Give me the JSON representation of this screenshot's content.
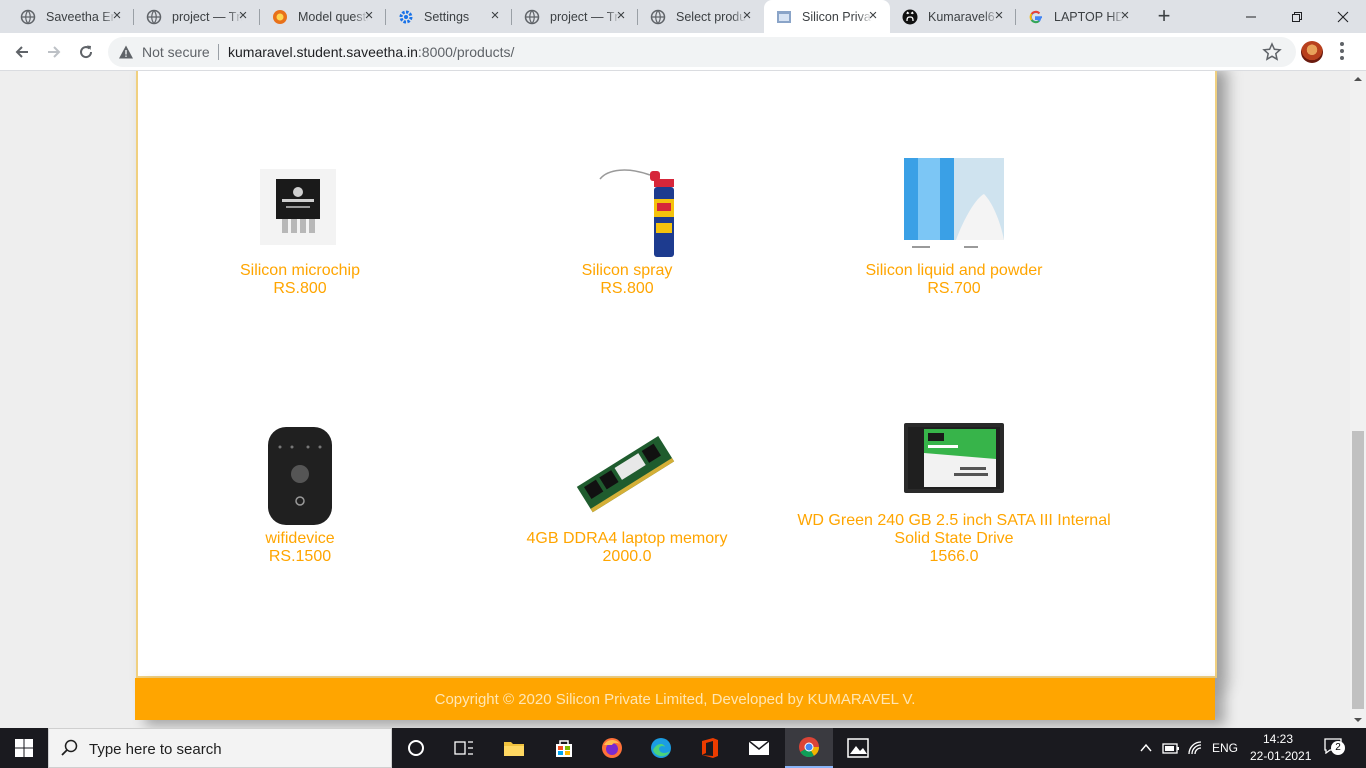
{
  "browser": {
    "tabs": [
      {
        "title": "Saveetha Engineering College",
        "icon": "saveetha-globe-icon",
        "active": false
      },
      {
        "title": "project — Tmp",
        "icon": "globe-icon",
        "active": false
      },
      {
        "title": "Model question",
        "icon": "model-question-icon",
        "active": false
      },
      {
        "title": "Settings",
        "icon": "gear-icon",
        "active": false
      },
      {
        "title": "project — Tmp",
        "icon": "globe-icon",
        "active": false
      },
      {
        "title": "Select product",
        "icon": "globe-icon",
        "active": false
      },
      {
        "title": "Silicon Private Limited",
        "icon": "page-thumbnail-icon",
        "active": true
      },
      {
        "title": "Kumaravel6",
        "icon": "github-icon",
        "active": false
      },
      {
        "title": "LAPTOP HD",
        "icon": "google-icon",
        "active": false
      }
    ],
    "security_label": "Not secure",
    "url_host": "kumaravel.student.saveetha.in",
    "url_rest": ":8000/products/"
  },
  "page": {
    "products": [
      {
        "name": "Silicon microchip",
        "price": "RS.800",
        "image": "microchip-image"
      },
      {
        "name": "Silicon spray",
        "price": "RS.800",
        "image": "spray-can-image"
      },
      {
        "name": "Silicon liquid and powder",
        "price": "RS.700",
        "image": "liquid-powder-image"
      },
      {
        "name": "wifidevice",
        "price": "RS.1500",
        "image": "jio-wifi-image"
      },
      {
        "name": "4GB DDRA4 laptop memory",
        "price": "2000.0",
        "image": "ram-module-image"
      },
      {
        "name": "WD Green 240 GB 2.5 inch SATA III Internal Solid State Drive",
        "price": "1566.0",
        "image": "ssd-image"
      }
    ],
    "footer": "Copyright © 2020 Silicon Private Limited, Developed by KUMARAVEL V."
  },
  "taskbar": {
    "search_placeholder": "Type here to search",
    "language": "ENG",
    "time": "14:23",
    "date": "22-01-2021",
    "notification_count": "2"
  },
  "colors": {
    "accent_orange": "#ffa500",
    "tabstrip": "#dee1e6",
    "taskbar": "#1a1a1f"
  }
}
